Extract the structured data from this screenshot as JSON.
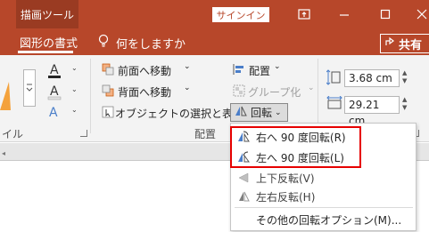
{
  "titlebar": {
    "context_group": "描画ツール",
    "signin": "サインイン",
    "icons": [
      "restore-ribbon-icon",
      "minimize-icon",
      "maximize-icon",
      "close-icon"
    ]
  },
  "tabs": {
    "active": "図形の書式",
    "tell_me": "何をしますか",
    "share": "共有"
  },
  "ribbon": {
    "bring_forward": "前面へ移動",
    "send_backward": "背面へ移動",
    "selection_pane": "オブジェクトの選択と表示",
    "align": "配置",
    "group": "グループ化",
    "rotate": "回転",
    "group_label_arrange": "配置",
    "group_label_left_partial": "イル",
    "height": "3.68 cm",
    "width": "29.21 cm"
  },
  "menu": {
    "items": [
      {
        "label": "右へ 90 度回転(R)",
        "icon": "rotate-right-icon"
      },
      {
        "label": "左へ 90 度回転(L)",
        "icon": "rotate-left-icon"
      },
      {
        "label": "上下反転(V)",
        "icon": "flip-vertical-icon"
      },
      {
        "label": "左右反転(H)",
        "icon": "flip-horizontal-icon"
      },
      {
        "label": "その他の回転オプション(M)...",
        "icon": ""
      }
    ]
  },
  "colors": {
    "accent": "#b7472a",
    "highlight": "#e60000"
  }
}
